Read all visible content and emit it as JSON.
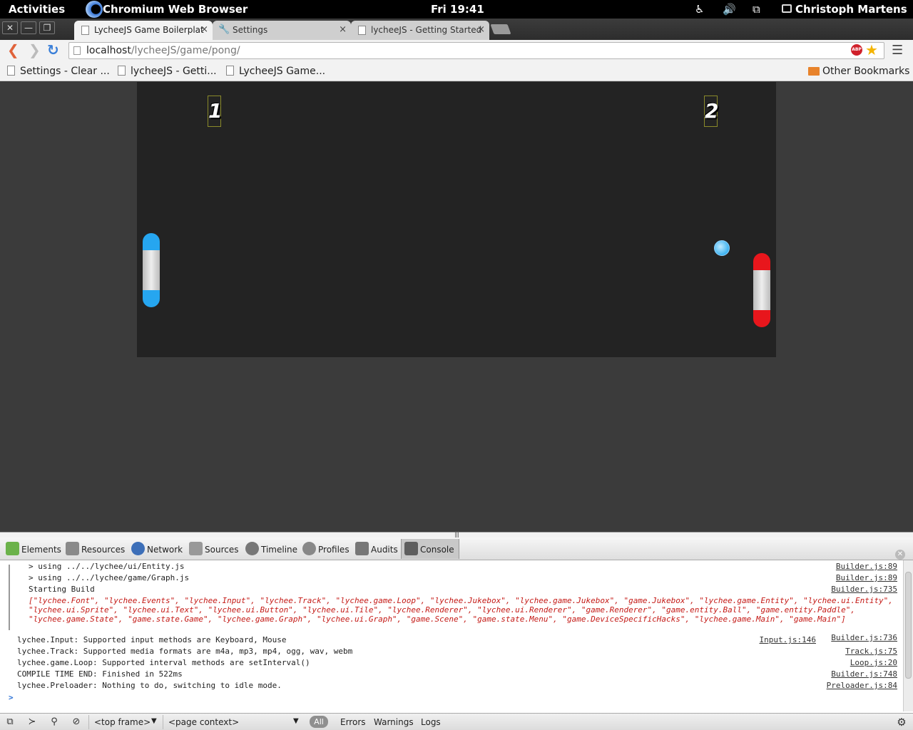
{
  "topbar": {
    "activities": "Activities",
    "app_name": "Chromium Web Browser",
    "clock": "Fri 19:41",
    "user": "Christoph Martens"
  },
  "tabs": [
    {
      "title": "LycheeJS Game Boilerplat",
      "state": "active"
    },
    {
      "title": "Settings",
      "state": "inactive"
    },
    {
      "title": "lycheeJS - Getting Started",
      "state": "inactive"
    }
  ],
  "address": {
    "host": "localhost",
    "path": "/lycheeJS/game/pong/",
    "abp_label": "ABP"
  },
  "bookmarks": {
    "items": [
      "Settings - Clear ...",
      "lycheeJS - Getti...",
      "LycheeJS Game..."
    ],
    "other": "Other Bookmarks"
  },
  "game": {
    "score_left": "1",
    "score_right": "2",
    "colors": {
      "left_paddle": "#26a6f0",
      "right_paddle": "#e8161c",
      "background": "#232323"
    }
  },
  "devtools": {
    "tabs": [
      "Elements",
      "Resources",
      "Network",
      "Sources",
      "Timeline",
      "Profiles",
      "Audits",
      "Console"
    ],
    "selected_tab": "Console",
    "console": [
      {
        "text": "> using ../../lychee/ui/Entity.js",
        "source": "Builder.js:89"
      },
      {
        "text": "> using ../../lychee/game/Graph.js",
        "source": "Builder.js:89"
      },
      {
        "text": "Starting Build",
        "source": "Builder.js:735"
      },
      {
        "text": "[\"lychee.Font\", \"lychee.Events\", \"lychee.Input\", \"lychee.Track\", \"lychee.game.Loop\", \"lychee.Jukebox\", \"lychee.game.Jukebox\", \"game.Jukebox\", \"lychee.game.Entity\", \"lychee.ui.Entity\", \"lychee.ui.Sprite\", \"lychee.ui.Text\", \"lychee.ui.Button\", \"lychee.ui.Tile\", \"lychee.Renderer\", \"lychee.ui.Renderer\", \"game.Renderer\", \"game.entity.Ball\", \"game.entity.Paddle\", \"lychee.game.State\", \"game.state.Game\", \"lychee.game.Graph\", \"lychee.ui.Graph\", \"game.Scene\", \"game.state.Menu\", \"game.DeviceSpecificHacks\", \"lychee.game.Main\", \"game.Main\"]",
        "source": ""
      },
      {
        "text": "lychee.Input: Supported input methods are Keyboard, Mouse",
        "source": "Builder.js:736",
        "source2": "Input.js:146"
      },
      {
        "text": "lychee.Track: Supported media formats are m4a, mp3, mp4, ogg, wav, webm",
        "source": "Track.js:75"
      },
      {
        "text": "lychee.game.Loop: Supported interval methods are setInterval()",
        "source": "Loop.js:20"
      },
      {
        "text": "COMPILE TIME END: Finished in 522ms",
        "source": "Builder.js:748"
      },
      {
        "text": "lychee.Preloader: Nothing to do, switching to idle mode.",
        "source": "Preloader.js:84"
      }
    ],
    "prompt": ">",
    "status": {
      "frame": "<top frame>",
      "context": "<page context>",
      "all": "All",
      "errors": "Errors",
      "warnings": "Warnings",
      "logs": "Logs"
    }
  }
}
